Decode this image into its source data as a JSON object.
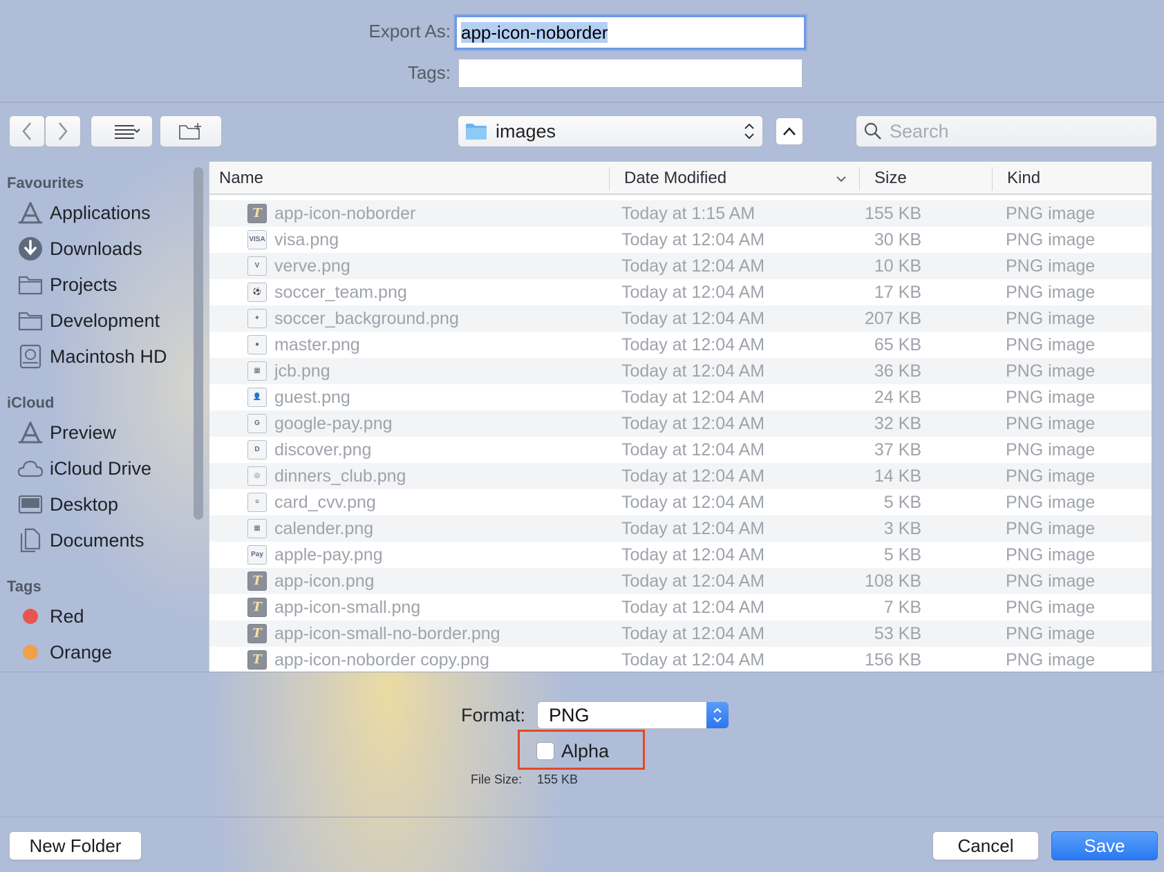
{
  "export": {
    "export_as_label": "Export As:",
    "filename": "app-icon-noborder",
    "tags_label": "Tags:",
    "tags_value": ""
  },
  "toolbar": {
    "location": "images",
    "search_placeholder": "Search"
  },
  "sidebar": {
    "favourites_title": "Favourites",
    "favourites": [
      {
        "label": "Applications",
        "icon": "applications-icon"
      },
      {
        "label": "Downloads",
        "icon": "downloads-icon"
      },
      {
        "label": "Projects",
        "icon": "folder-icon"
      },
      {
        "label": "Development",
        "icon": "folder-icon"
      },
      {
        "label": "Macintosh HD",
        "icon": "hard-drive-icon"
      }
    ],
    "icloud_title": "iCloud",
    "icloud": [
      {
        "label": "Preview",
        "icon": "applications-icon"
      },
      {
        "label": "iCloud Drive",
        "icon": "cloud-icon"
      },
      {
        "label": "Desktop",
        "icon": "desktop-icon"
      },
      {
        "label": "Documents",
        "icon": "documents-icon"
      }
    ],
    "tags_title": "Tags",
    "tags": [
      {
        "label": "Red",
        "color": "#e8554e"
      },
      {
        "label": "Orange",
        "color": "#f0a04b"
      }
    ]
  },
  "filelist": {
    "columns": [
      "Name",
      "Date Modified",
      "Size",
      "Kind"
    ],
    "rows": [
      {
        "name": "app-icon-noborder",
        "date": "Today at 1:15 AM",
        "size": "155 KB",
        "kind": "PNG image",
        "icon": "app"
      },
      {
        "name": "visa.png",
        "date": "Today at 12:04 AM",
        "size": "30 KB",
        "kind": "PNG image",
        "icon": "visa"
      },
      {
        "name": "verve.png",
        "date": "Today at 12:04 AM",
        "size": "10 KB",
        "kind": "PNG image",
        "icon": "verve"
      },
      {
        "name": "soccer_team.png",
        "date": "Today at 12:04 AM",
        "size": "17 KB",
        "kind": "PNG image",
        "icon": "ball"
      },
      {
        "name": "soccer_background.png",
        "date": "Today at 12:04 AM",
        "size": "207 KB",
        "kind": "PNG image",
        "icon": "player"
      },
      {
        "name": "master.png",
        "date": "Today at 12:04 AM",
        "size": "65 KB",
        "kind": "PNG image",
        "icon": "master"
      },
      {
        "name": "jcb.png",
        "date": "Today at 12:04 AM",
        "size": "36 KB",
        "kind": "PNG image",
        "icon": "jcb"
      },
      {
        "name": "guest.png",
        "date": "Today at 12:04 AM",
        "size": "24 KB",
        "kind": "PNG image",
        "icon": "guest"
      },
      {
        "name": "google-pay.png",
        "date": "Today at 12:04 AM",
        "size": "32 KB",
        "kind": "PNG image",
        "icon": "gpay"
      },
      {
        "name": "discover.png",
        "date": "Today at 12:04 AM",
        "size": "37 KB",
        "kind": "PNG image",
        "icon": "discover"
      },
      {
        "name": "dinners_club.png",
        "date": "Today at 12:04 AM",
        "size": "14 KB",
        "kind": "PNG image",
        "icon": "diners"
      },
      {
        "name": "card_cvv.png",
        "date": "Today at 12:04 AM",
        "size": "5 KB",
        "kind": "PNG image",
        "icon": "cvv"
      },
      {
        "name": "calender.png",
        "date": "Today at 12:04 AM",
        "size": "3 KB",
        "kind": "PNG image",
        "icon": "calendar"
      },
      {
        "name": "apple-pay.png",
        "date": "Today at 12:04 AM",
        "size": "5 KB",
        "kind": "PNG image",
        "icon": "applepay"
      },
      {
        "name": "app-icon.png",
        "date": "Today at 12:04 AM",
        "size": "108 KB",
        "kind": "PNG image",
        "icon": "app"
      },
      {
        "name": "app-icon-small.png",
        "date": "Today at 12:04 AM",
        "size": "7 KB",
        "kind": "PNG image",
        "icon": "app"
      },
      {
        "name": "app-icon-small-no-border.png",
        "date": "Today at 12:04 AM",
        "size": "53 KB",
        "kind": "PNG image",
        "icon": "app"
      },
      {
        "name": "app-icon-noborder copy.png",
        "date": "Today at 12:04 AM",
        "size": "156 KB",
        "kind": "PNG image",
        "icon": "app"
      }
    ]
  },
  "options": {
    "format_label": "Format:",
    "format_value": "PNG",
    "alpha_label": "Alpha",
    "alpha_checked": false,
    "file_size_label": "File Size:",
    "file_size_value": "155 KB"
  },
  "buttons": {
    "new_folder": "New Folder",
    "cancel": "Cancel",
    "save": "Save"
  },
  "colors": {
    "accent": "#2979f2",
    "highlight": "#e2472a",
    "tag_red": "#e8554e",
    "tag_orange": "#f0a04b"
  }
}
